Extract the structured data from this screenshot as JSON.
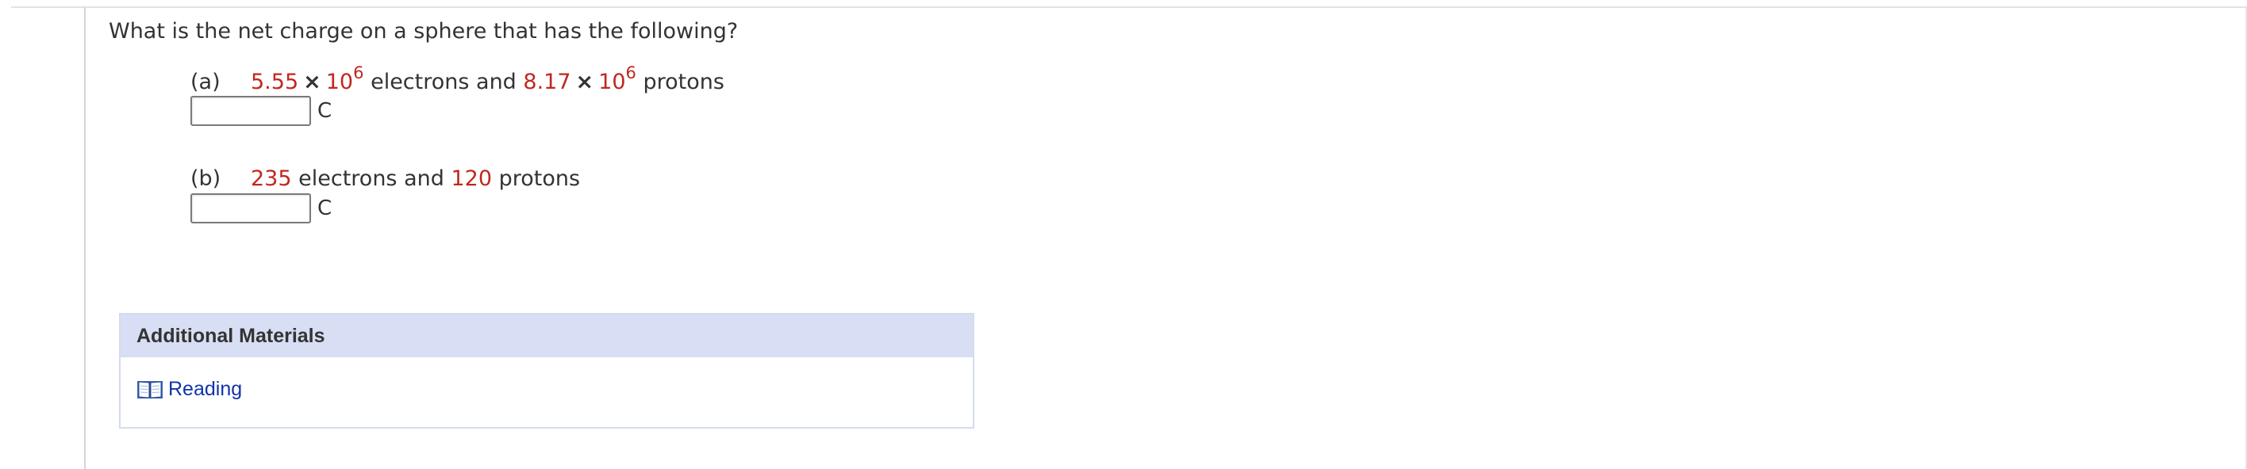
{
  "question": {
    "text": "What is the net charge on a sphere that has the following?"
  },
  "parts": {
    "a": {
      "label": "(a)",
      "electrons_mantissa": "5.55",
      "times": "×",
      "electrons_base": "10",
      "electrons_exponent": "6",
      "electrons_word": "electrons and",
      "protons_mantissa": "8.17",
      "protons_base": "10",
      "protons_exponent": "6",
      "protons_word": "protons",
      "answer_value": "",
      "unit": "C"
    },
    "b": {
      "label": "(b)",
      "electrons": "235",
      "electrons_word": "electrons and",
      "protons": "120",
      "protons_word": "protons",
      "answer_value": "",
      "unit": "C"
    }
  },
  "additional_materials": {
    "title": "Additional Materials",
    "link_label": "Reading",
    "link_icon": "book-icon"
  },
  "colors": {
    "given_value": "#c0281e",
    "header_background": "#d8def3",
    "link": "#1133aa"
  }
}
